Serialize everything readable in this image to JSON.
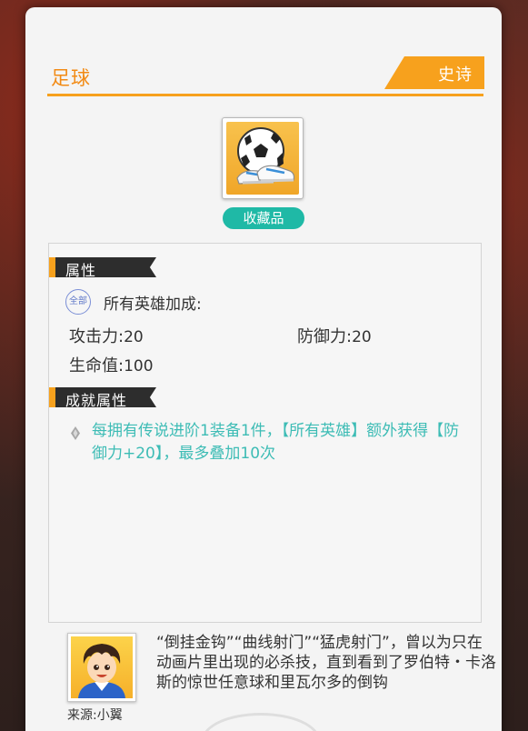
{
  "item": {
    "name": "足球",
    "rarity": "史诗",
    "tag": "收藏品",
    "icon": "soccer-ball-and-sneakers-icon"
  },
  "attributes": {
    "heading": "属性",
    "scope_badge": "全部",
    "scope_text": "所有英雄加成:",
    "stats": [
      {
        "label": "攻击力:",
        "value": "20"
      },
      {
        "label": "防御力:",
        "value": "20"
      },
      {
        "label": "生命值:",
        "value": "100"
      }
    ]
  },
  "achievement": {
    "heading": "成就属性",
    "text": "每拥有传说进阶1装备1件，【所有英雄】额外获得【防御力+20】，最多叠加10次"
  },
  "footer": {
    "source": "来源:小翼",
    "description": "“倒挂金钩”“曲线射门”“猛虎射门”，曾以为只在动画片里出现的必杀技，直到看到了罗伯特・卡洛斯的惊世任意球和里瓦尔多的倒钩"
  },
  "colors": {
    "accent": "#f7a11d",
    "title": "#f28a14",
    "teal": "#1fb9a6",
    "achievement_text": "#3dbcb5",
    "section_header": "#2d2d2d"
  }
}
